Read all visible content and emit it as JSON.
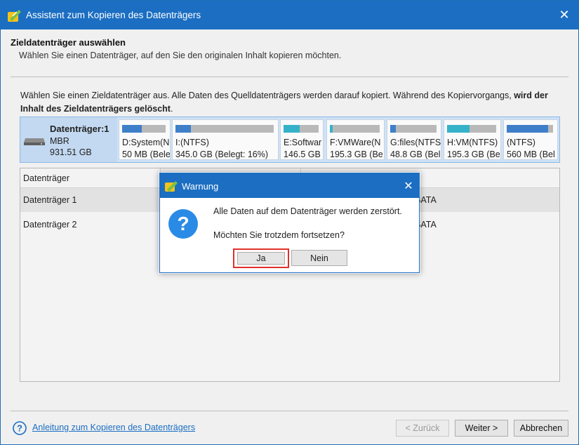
{
  "window": {
    "title": "Assistent zum Kopieren des Datenträgers"
  },
  "header": {
    "title": "Zieldatenträger auswählen",
    "subtitle": "Wählen Sie einen Datenträger, auf den Sie den originalen Inhalt kopieren möchten."
  },
  "instruction": {
    "normal_part": "Wählen Sie einen Zieldatenträger aus. Alle Daten des Quelldatenträgers werden darauf kopiert. Während des Kopiervorgangs, ",
    "bold_part": "wird der Inhalt des Zieldatenträgers gelöscht",
    "end": "."
  },
  "disk_map": {
    "name": "Datenträger:1",
    "type": "MBR",
    "size": "931.51 GB",
    "partitions": [
      {
        "label": "D:System(N",
        "detail": "50 MB (Bele",
        "used": 0.45,
        "color": "#3f7fca"
      },
      {
        "label": "I:(NTFS)",
        "detail": "345.0 GB (Belegt: 16%)",
        "used": 0.16,
        "color": "#3f7fca"
      },
      {
        "label": "E:Softwar",
        "detail": "146.5 GB",
        "used": 0.45,
        "color": "#35b2c9"
      },
      {
        "label": "F:VMWare(N",
        "detail": "195.3 GB (Be",
        "used": 0.05,
        "color": "#35b2c9"
      },
      {
        "label": "G:files(NTFS",
        "detail": "48.8 GB (Bel",
        "used": 0.12,
        "color": "#3f7fca"
      },
      {
        "label": "H:VM(NTFS)",
        "detail": "195.3 GB (Bel",
        "used": 0.45,
        "color": "#35b2c9"
      },
      {
        "label": "(NTFS)",
        "detail": "560 MB (Bel",
        "used": 0.9,
        "color": "#3f7fca"
      }
    ]
  },
  "table": {
    "column_header": "Datenträger",
    "rows": [
      {
        "name": "Datenträger 1",
        "interface": "SATA"
      },
      {
        "name": "Datenträger 2",
        "interface": "SATA"
      }
    ]
  },
  "footer": {
    "help_link": "Anleitung zum Kopieren des Datenträgers",
    "back": "< Zurück",
    "next": "Weiter >",
    "cancel": "Abbrechen"
  },
  "dialog": {
    "title": "Warnung",
    "message1": "Alle Daten auf dem Datenträger werden zerstört.",
    "message2": "Möchten Sie trotzdem fortsetzen?",
    "yes": "Ja",
    "no": "Nein"
  }
}
